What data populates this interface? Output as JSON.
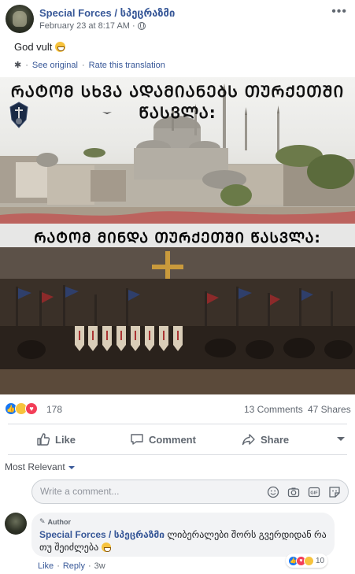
{
  "post": {
    "page_name": "Special Forces / სპეცრაზმი",
    "timestamp": "February 23 at 8:17 AM",
    "meta_separator": "·",
    "text": "God vult",
    "translation": {
      "see_original": "See original",
      "separator": "·",
      "rate": "Rate this translation"
    },
    "image": {
      "caption_top": "ᲠᲐᲢᲝᲛ ᲡᲮᲕᲐ ᲐᲓᲐᲛᲘᲐᲜᲔᲑᲡ ᲗᲣᲠᲥᲔᲗᲨᲘ ᲬᲐᲡᲕᲚᲐ:",
      "caption_bottom": "ᲠᲐᲢᲝᲛ ᲛᲘᲜᲓᲐ ᲗᲣᲠᲥᲔᲗᲨᲘ ᲬᲐᲡᲕᲚᲐ:"
    }
  },
  "stats": {
    "reactions": "178",
    "comments": "13 Comments",
    "shares": "47 Shares"
  },
  "actions": {
    "like": "Like",
    "comment": "Comment",
    "share": "Share"
  },
  "comments_section": {
    "sort_label": "Most Relevant",
    "input_placeholder": "Write a comment...",
    "comment": {
      "badge": "Author",
      "author": "Special Forces / სპეცრაზმი",
      "text": "ლიბერალები შორს გვერდიდან რა თუ შეიძლება",
      "reaction_count": "10",
      "like": "Like",
      "reply": "Reply",
      "separator": "·",
      "age": "3w"
    }
  },
  "colors": {
    "link": "#385898",
    "like_blue": "#1877f2",
    "love_red": "#f33e58",
    "haha_yellow": "#f7c33d"
  },
  "icons": [
    "more-options-icon",
    "globe-icon",
    "gear-icon",
    "like-icon",
    "comment-icon",
    "share-icon",
    "emoji-icon",
    "camera-icon",
    "gif-icon",
    "sticker-icon",
    "pencil-icon"
  ]
}
